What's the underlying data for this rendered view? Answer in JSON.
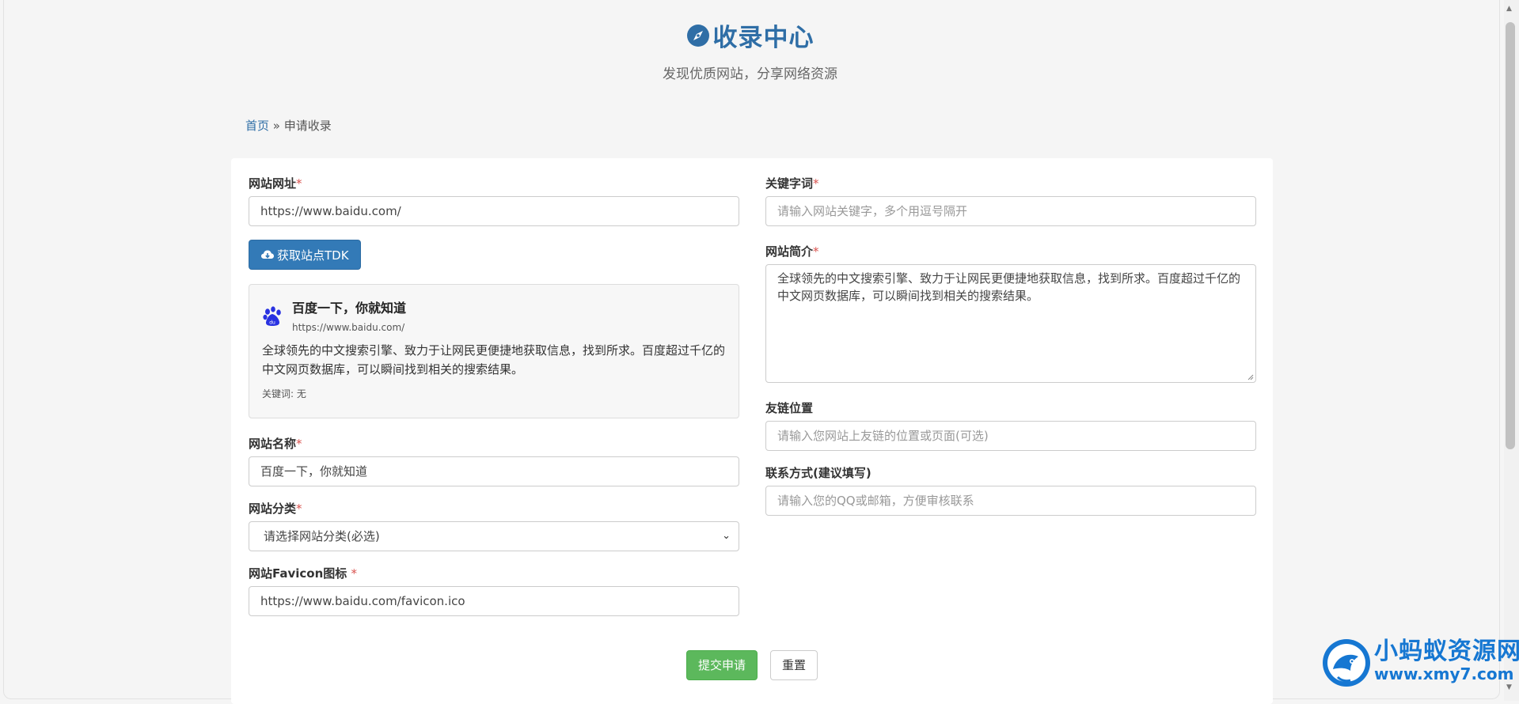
{
  "header": {
    "title": "收录中心",
    "subtitle": "发现优质网站，分享网络资源"
  },
  "breadcrumb": {
    "home": "首页",
    "separator": "»",
    "current": "申请收录"
  },
  "form": {
    "url": {
      "label": "网站网址",
      "required": "*",
      "value": "https://www.baidu.com/"
    },
    "fetch_button": "获取站点TDK",
    "preview": {
      "title": "百度一下，你就知道",
      "url": "https://www.baidu.com/",
      "description": "全球领先的中文搜索引擎、致力于让网民更便捷地获取信息，找到所求。百度超过千亿的中文网页数据库，可以瞬间找到相关的搜索结果。",
      "keywords_label": "关键词:",
      "keywords_value": "无"
    },
    "name": {
      "label": "网站名称",
      "required": "*",
      "value": "百度一下，你就知道"
    },
    "category": {
      "label": "网站分类",
      "required": "*",
      "selected": "请选择网站分类(必选)"
    },
    "favicon": {
      "label": "网站Favicon图标",
      "required": "*",
      "value": "https://www.baidu.com/favicon.ico"
    },
    "keywords": {
      "label": "关键字词",
      "required": "*",
      "placeholder": "请输入网站关键字，多个用逗号隔开"
    },
    "intro": {
      "label": "网站简介",
      "required": "*",
      "value": "全球领先的中文搜索引擎、致力于让网民更便捷地获取信息，找到所求。百度超过千亿的中文网页数据库，可以瞬间找到相关的搜索结果。"
    },
    "link_position": {
      "label": "友链位置",
      "placeholder": "请输入您网站上友链的位置或页面(可选)"
    },
    "contact": {
      "label": "联系方式(建议填写)",
      "placeholder": "请输入您的QQ或邮箱，方便审核联系"
    },
    "submit_button": "提交申请",
    "reset_button": "重置"
  },
  "watermark": {
    "name": "小蚂蚁资源网",
    "url": "www.xmy7.com"
  },
  "colors": {
    "primary": "#337ab7",
    "title": "#2f6ea6",
    "success": "#5cb85c",
    "required": "#d9534f"
  }
}
